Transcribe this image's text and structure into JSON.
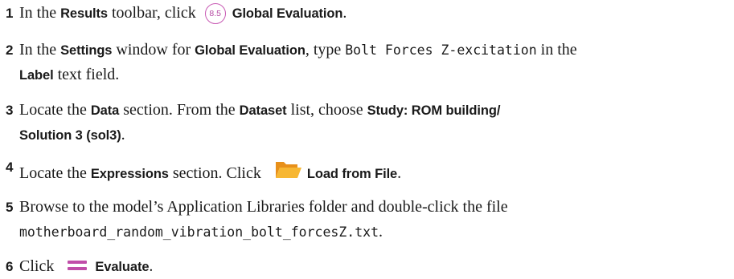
{
  "steps": [
    {
      "number": "1",
      "lines": [
        {
          "segments": [
            {
              "type": "text",
              "text": "In the "
            },
            {
              "type": "ui",
              "text": "Results"
            },
            {
              "type": "text",
              "text": " toolbar, click "
            },
            {
              "type": "icon",
              "icon": "global-evaluation-badge-icon",
              "text": "8.5"
            },
            {
              "type": "ui",
              "text": "Global Evaluation"
            },
            {
              "type": "text",
              "text": "."
            }
          ]
        }
      ]
    },
    {
      "number": "2",
      "lines": [
        {
          "segments": [
            {
              "type": "text",
              "text": "In the "
            },
            {
              "type": "ui",
              "text": "Settings"
            },
            {
              "type": "text",
              "text": " window for "
            },
            {
              "type": "ui",
              "text": "Global Evaluation"
            },
            {
              "type": "text",
              "text": ", type "
            },
            {
              "type": "mono",
              "text": "Bolt Forces Z-excitation"
            },
            {
              "type": "text",
              "text": " in the"
            }
          ]
        },
        {
          "segments": [
            {
              "type": "ui",
              "text": "Label"
            },
            {
              "type": "text",
              "text": " text field."
            }
          ]
        }
      ]
    },
    {
      "number": "3",
      "lines": [
        {
          "segments": [
            {
              "type": "text",
              "text": "Locate the "
            },
            {
              "type": "ui",
              "text": "Data"
            },
            {
              "type": "text",
              "text": " section. From the "
            },
            {
              "type": "ui",
              "text": "Dataset"
            },
            {
              "type": "text",
              "text": " list, choose "
            },
            {
              "type": "ui",
              "text": "Study: ROM building/"
            }
          ]
        },
        {
          "segments": [
            {
              "type": "ui",
              "text": "Solution 3 (sol3)"
            },
            {
              "type": "text",
              "text": "."
            }
          ]
        }
      ]
    },
    {
      "number": "4",
      "lines": [
        {
          "segments": [
            {
              "type": "text",
              "text": "Locate the "
            },
            {
              "type": "ui",
              "text": "Expressions"
            },
            {
              "type": "text",
              "text": " section. Click "
            },
            {
              "type": "icon",
              "icon": "folder-open-icon",
              "text": ""
            },
            {
              "type": "ui",
              "text": "Load from File"
            },
            {
              "type": "text",
              "text": "."
            }
          ]
        }
      ]
    },
    {
      "number": "5",
      "lines": [
        {
          "segments": [
            {
              "type": "text",
              "text": "Browse to the model’s Application Libraries folder and double-click the file"
            }
          ]
        },
        {
          "segments": [
            {
              "type": "mono",
              "text": "motherboard_random_vibration_bolt_forcesZ.txt"
            },
            {
              "type": "text",
              "text": "."
            }
          ]
        }
      ]
    },
    {
      "number": "6",
      "lines": [
        {
          "segments": [
            {
              "type": "text",
              "text": "Click "
            },
            {
              "type": "icon",
              "icon": "evaluate-icon",
              "text": ""
            },
            {
              "type": "ui",
              "text": "Evaluate"
            },
            {
              "type": "text",
              "text": "."
            }
          ]
        }
      ]
    }
  ],
  "colors": {
    "accent": "#c04ea9",
    "folder_light": "#f7b733",
    "folder_dark": "#e8901a"
  }
}
